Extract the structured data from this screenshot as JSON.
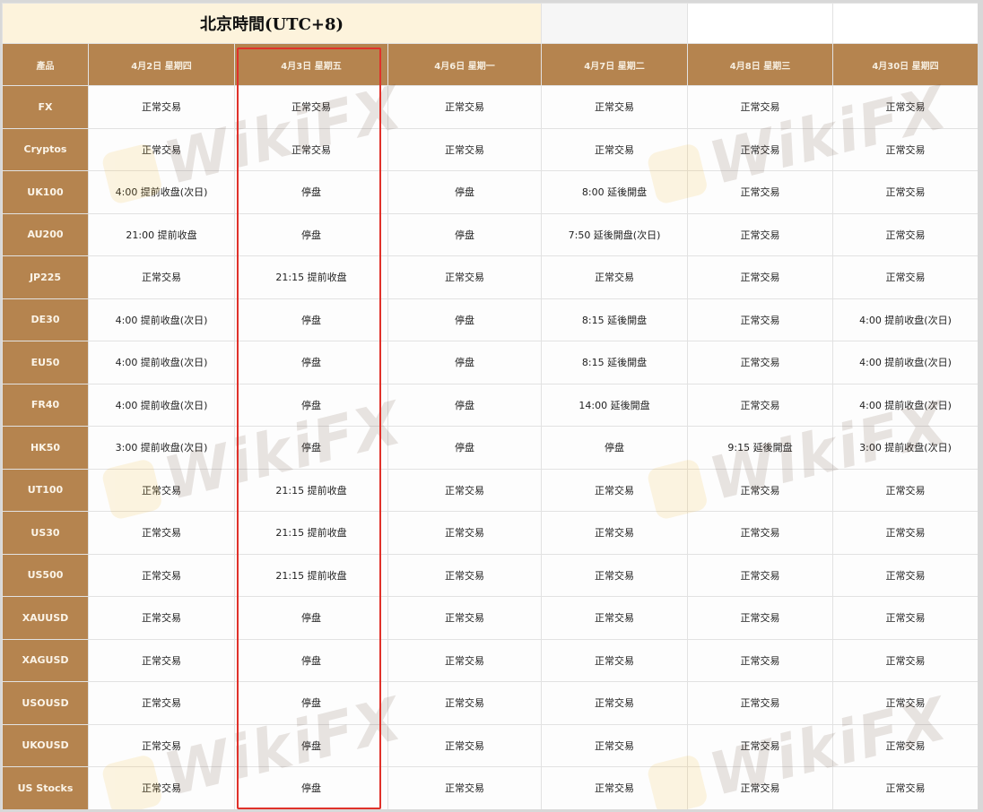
{
  "title": "北京時間(UTC+8)",
  "headers": [
    "產品",
    "4月2日 星期四",
    "4月3日 星期五",
    "4月6日 星期一",
    "4月7日 星期二",
    "4月8日 星期三",
    "4月30日 星期四"
  ],
  "rows": [
    [
      "FX",
      "正常交易",
      "正常交易",
      "正常交易",
      "正常交易",
      "正常交易",
      "正常交易"
    ],
    [
      "Cryptos",
      "正常交易",
      "正常交易",
      "正常交易",
      "正常交易",
      "正常交易",
      "正常交易"
    ],
    [
      "UK100",
      "4:00 提前收盘(次日)",
      "停盘",
      "停盘",
      "8:00 延後開盘",
      "正常交易",
      "正常交易"
    ],
    [
      "AU200",
      "21:00 提前收盘",
      "停盘",
      "停盘",
      "7:50 延後開盘(次日)",
      "正常交易",
      "正常交易"
    ],
    [
      "JP225",
      "正常交易",
      "21:15 提前收盘",
      "正常交易",
      "正常交易",
      "正常交易",
      "正常交易"
    ],
    [
      "DE30",
      "4:00 提前收盘(次日)",
      "停盘",
      "停盘",
      "8:15 延後開盘",
      "正常交易",
      "4:00 提前收盘(次日)"
    ],
    [
      "EU50",
      "4:00 提前收盘(次日)",
      "停盘",
      "停盘",
      "8:15 延後開盘",
      "正常交易",
      "4:00 提前收盘(次日)"
    ],
    [
      "FR40",
      "4:00 提前收盘(次日)",
      "停盘",
      "停盘",
      "14:00 延後開盘",
      "正常交易",
      "4:00 提前收盘(次日)"
    ],
    [
      "HK50",
      "3:00 提前收盘(次日)",
      "停盘",
      "停盘",
      "停盘",
      "9:15 延後開盘",
      "3:00 提前收盘(次日)"
    ],
    [
      "UT100",
      "正常交易",
      "21:15 提前收盘",
      "正常交易",
      "正常交易",
      "正常交易",
      "正常交易"
    ],
    [
      "US30",
      "正常交易",
      "21:15 提前收盘",
      "正常交易",
      "正常交易",
      "正常交易",
      "正常交易"
    ],
    [
      "US500",
      "正常交易",
      "21:15 提前收盘",
      "正常交易",
      "正常交易",
      "正常交易",
      "正常交易"
    ],
    [
      "XAUUSD",
      "正常交易",
      "停盘",
      "正常交易",
      "正常交易",
      "正常交易",
      "正常交易"
    ],
    [
      "XAGUSD",
      "正常交易",
      "停盘",
      "正常交易",
      "正常交易",
      "正常交易",
      "正常交易"
    ],
    [
      "USOUSD",
      "正常交易",
      "停盘",
      "正常交易",
      "正常交易",
      "正常交易",
      "正常交易"
    ],
    [
      "UKOUSD",
      "正常交易",
      "停盘",
      "正常交易",
      "正常交易",
      "正常交易",
      "正常交易"
    ],
    [
      "US Stocks",
      "正常交易",
      "停盘",
      "正常交易",
      "正常交易",
      "正常交易",
      "正常交易"
    ]
  ],
  "watermark": "WikiFX",
  "colors": {
    "header_bg": "#b5844f",
    "title_bg": "#fdf3dc",
    "highlight": "#e0312a"
  }
}
